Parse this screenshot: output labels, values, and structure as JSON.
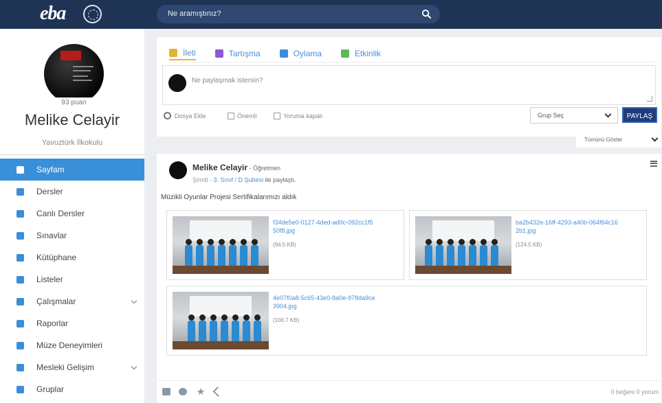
{
  "header": {
    "logo": "eba",
    "emblem_icon": "meb-emblem-icon",
    "search_placeholder": "Ne aramıştınız?",
    "search_icon": "search-icon",
    "bar_color": "#1f3455"
  },
  "profile": {
    "avatar_lines": [
      "Atatürkçü olmak bir erdemdir",
      "Ona her zaman borçluyuz"
    ],
    "points": "93 puan",
    "name": "Melike Celayir",
    "school": "Yavuztürk İlkokulu"
  },
  "sidebar": {
    "accent": "#3a8fd9",
    "items": [
      {
        "label": "Sayfam",
        "icon": "user-icon",
        "active": true,
        "chevron": false
      },
      {
        "label": "Dersler",
        "icon": "play-circle-icon",
        "active": false,
        "chevron": false
      },
      {
        "label": "Canlı Dersler",
        "icon": "video-icon",
        "active": false,
        "chevron": false
      },
      {
        "label": "Sınavlar",
        "icon": "pencil-icon",
        "active": false,
        "chevron": false
      },
      {
        "label": "Kütüphane",
        "icon": "book-icon",
        "active": false,
        "chevron": false
      },
      {
        "label": "Listeler",
        "icon": "list-icon",
        "active": false,
        "chevron": false
      },
      {
        "label": "Çalışmalar",
        "icon": "tasks-icon",
        "active": false,
        "chevron": true
      },
      {
        "label": "Raporlar",
        "icon": "pie-chart-icon",
        "active": false,
        "chevron": false
      },
      {
        "label": "Müze Deneyimleri",
        "icon": "museum-icon",
        "active": false,
        "chevron": false
      },
      {
        "label": "Mesleki Gelişim",
        "icon": "graduation-cap-icon",
        "active": false,
        "chevron": true
      },
      {
        "label": "Gruplar",
        "icon": "users-icon",
        "active": false,
        "chevron": false
      }
    ]
  },
  "composer": {
    "tabs": [
      {
        "label": "İleti",
        "icon": "edit-icon",
        "color": "#e8b234",
        "active": true
      },
      {
        "label": "Tartışma",
        "icon": "comments-icon",
        "color": "#8a5bd0",
        "active": false
      },
      {
        "label": "Oylama",
        "icon": "bar-chart-icon",
        "color": "#3a8fd9",
        "active": false
      },
      {
        "label": "Etkinlik",
        "icon": "calendar-icon",
        "color": "#5cb85c",
        "active": false
      }
    ],
    "placeholder": "Ne paylaşmak istersin?",
    "attach_label": "Dosya Ekle",
    "important_label": "Önemli",
    "comments_closed_label": "Yoruma kapalı",
    "group_select": "Grup Seç",
    "share_label": "PAYLAŞ"
  },
  "filter": {
    "label": "Tümünü Göster"
  },
  "post": {
    "author": "Melike Celayir",
    "role": " - Öğretmen",
    "time": "Şimdi",
    "separator": " - ",
    "class_link": "3. Sınıf / D Şubesi",
    "shared_text": " ile paylaştı.",
    "text": "Müzikli Oyunlar Projesi Sertifikalarımızı aldık",
    "attachments": [
      {
        "name": "f34de5e0-0127-4ded-ad0c-092cc1f550f8.jpg",
        "size": "(94.5 KB)"
      },
      {
        "name": "ba2b432e-16ff-4293-a40b-064f64c162b1.jpg",
        "size": "(124.5 KB)"
      },
      {
        "name": "4e07f0a8-5c65-43e0-8a0e-978da9ce3904.jpg",
        "size": "(106.7 KB)"
      }
    ],
    "footer_icons": [
      "thumbs-up-icon",
      "comment-icon",
      "star-icon",
      "share-icon"
    ],
    "likes": "0 beğeni",
    "comments": "0 yorum"
  }
}
